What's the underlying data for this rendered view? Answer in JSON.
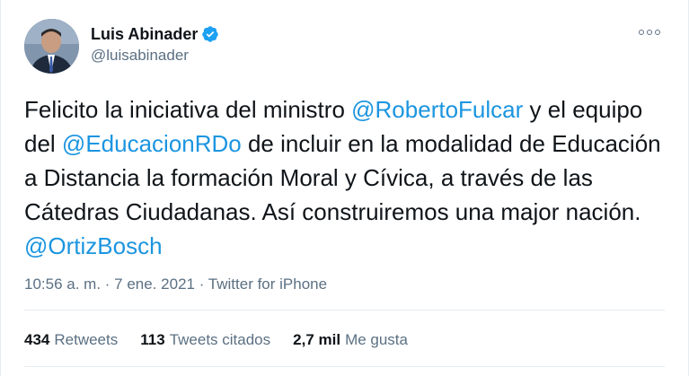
{
  "author": {
    "display_name": "Luis Abinader",
    "handle": "@luisabinader",
    "verified_icon": "verified-badge-icon",
    "accent_color": "#1da1f2"
  },
  "tweet": {
    "segments": [
      {
        "type": "text",
        "value": "Felicito la iniciativa del ministro "
      },
      {
        "type": "mention",
        "value": "@RobertoFulcar"
      },
      {
        "type": "text",
        "value": " y el equipo del "
      },
      {
        "type": "mention",
        "value": "@EducacionRDo"
      },
      {
        "type": "text",
        "value": " de incluir en la modalidad de Educación a Distancia la formación Moral y Cívica, a través de las Cátedras Ciudadanas. Así construiremos una major nación. "
      },
      {
        "type": "mention",
        "value": "@OrtizBosch"
      }
    ],
    "mention_color": "#1b95e0"
  },
  "meta": {
    "time": "10:56 a. m.",
    "separator": " · ",
    "date": "7 ene. 2021",
    "source": "Twitter for iPhone"
  },
  "stats": [
    {
      "value": "434",
      "label": "Retweets"
    },
    {
      "value": "113",
      "label": "Tweets citados"
    },
    {
      "value": "2,7 mil",
      "label": "Me gusta"
    }
  ],
  "more_icon": "more-options-icon"
}
